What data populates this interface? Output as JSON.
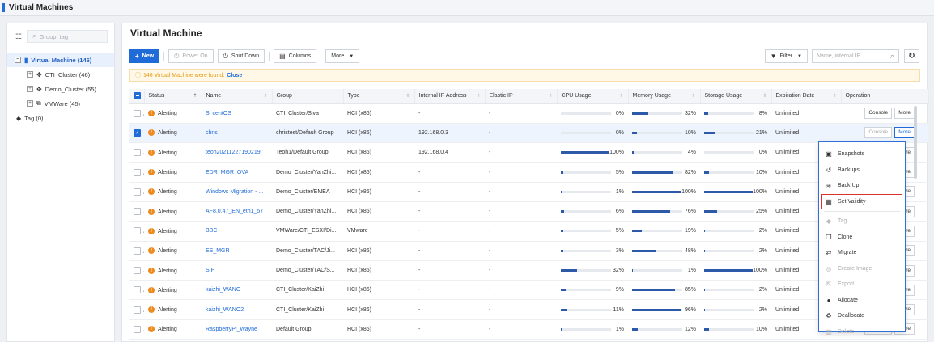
{
  "page": {
    "title": "Virtual Machines"
  },
  "sidebar": {
    "search_placeholder": "Group, tag",
    "tree": [
      {
        "label": "Virtual Machine (146)",
        "selected": true
      },
      {
        "label": "CTI_Cluster (46)"
      },
      {
        "label": "Demo_Cluster (55)"
      },
      {
        "label": "VMWare (45)"
      },
      {
        "label": "Tag (0)"
      }
    ]
  },
  "main": {
    "title": "Virtual Machine",
    "toolbar": {
      "new": "New",
      "power_on": "Power On",
      "shut_down": "Shut Down",
      "columns": "Columns",
      "more": "More",
      "filter": "Filter",
      "search_placeholder": "Name, internal IP"
    },
    "notice": {
      "text": "146 Virtual Machine were found.",
      "close": "Close"
    },
    "columns": [
      "Status",
      "Name",
      "Group",
      "Type",
      "Internal IP Address",
      "Elastic IP",
      "CPU Usage",
      "Memory Usage",
      "Storage Usage",
      "Expiration Date",
      "Operation"
    ],
    "operation_labels": {
      "console": "Console",
      "more": "More"
    },
    "rows": [
      {
        "status": "Alerting",
        "name": "S_centOS",
        "group": "CTI_Cluster/Siva",
        "type": "HCI (x86)",
        "ip": "-",
        "eip": "-",
        "cpu": 0,
        "cpu_label": "0%",
        "mem": 32,
        "mem_label": "32%",
        "sto": 8,
        "sto_label": "8%",
        "exp": "Unlimited",
        "checked": false
      },
      {
        "status": "Alerting",
        "name": "chris",
        "group": "christest/Default Group",
        "type": "HCI (x86)",
        "ip": "192.168.0.3",
        "eip": "-",
        "cpu": 0,
        "cpu_label": "0%",
        "mem": 10,
        "mem_label": "10%",
        "sto": 21,
        "sto_label": "21%",
        "exp": "Unlimited",
        "checked": true
      },
      {
        "status": "Alerting",
        "name": "teoh20211227190219",
        "group": "Teoh1/Default Group",
        "type": "HCI (x86)",
        "ip": "192.168.0.4",
        "eip": "-",
        "cpu": 100,
        "cpu_label": "100%",
        "mem": 4,
        "mem_label": "4%",
        "sto": 0,
        "sto_label": "0%",
        "exp": "Unlimited",
        "checked": false
      },
      {
        "status": "Alerting",
        "name": "EDR_MGR_OVA",
        "group": "Demo_Cluster/YanZhi...",
        "type": "HCI (x86)",
        "ip": "-",
        "eip": "-",
        "cpu": 5,
        "cpu_label": "5%",
        "mem": 82,
        "mem_label": "82%",
        "sto": 10,
        "sto_label": "10%",
        "exp": "Unlimited",
        "checked": false
      },
      {
        "status": "Alerting",
        "name": "Windows Migration - ...",
        "group": "Demo_Cluster/EMEA",
        "type": "HCI (x86)",
        "ip": "-",
        "eip": "-",
        "cpu": 1,
        "cpu_label": "1%",
        "mem": 100,
        "mem_label": "100%",
        "sto": 100,
        "sto_label": "100%",
        "exp": "Unlimited",
        "checked": false
      },
      {
        "status": "Alerting",
        "name": "AF8.0.47_EN_eth1_57",
        "group": "Demo_Cluster/YanZhi...",
        "type": "HCI (x86)",
        "ip": "-",
        "eip": "-",
        "cpu": 6,
        "cpu_label": "6%",
        "mem": 76,
        "mem_label": "76%",
        "sto": 25,
        "sto_label": "25%",
        "exp": "Unlimited",
        "checked": false
      },
      {
        "status": "Alerting",
        "name": "BBC",
        "group": "VMWare/CTI_ESXI/Di...",
        "type": "VMware",
        "ip": "-",
        "eip": "-",
        "cpu": 5,
        "cpu_label": "5%",
        "mem": 19,
        "mem_label": "19%",
        "sto": 2,
        "sto_label": "2%",
        "exp": "Unlimited",
        "checked": false
      },
      {
        "status": "Alerting",
        "name": "ES_MGR",
        "group": "Demo_Cluster/TAC/Ji...",
        "type": "HCI (x86)",
        "ip": "-",
        "eip": "-",
        "cpu": 3,
        "cpu_label": "3%",
        "mem": 48,
        "mem_label": "48%",
        "sto": 2,
        "sto_label": "2%",
        "exp": "Unlimited",
        "checked": false
      },
      {
        "status": "Alerting",
        "name": "SIP",
        "group": "Demo_Cluster/TAC/S...",
        "type": "HCI (x86)",
        "ip": "-",
        "eip": "-",
        "cpu": 32,
        "cpu_label": "32%",
        "mem": 1,
        "mem_label": "1%",
        "sto": 100,
        "sto_label": "100%",
        "exp": "Unlimited",
        "checked": false
      },
      {
        "status": "Alerting",
        "name": "kaizhi_WANO",
        "group": "CTI_Cluster/KaiZhi",
        "type": "HCI (x86)",
        "ip": "-",
        "eip": "-",
        "cpu": 9,
        "cpu_label": "9%",
        "mem": 85,
        "mem_label": "85%",
        "sto": 2,
        "sto_label": "2%",
        "exp": "Unlimited",
        "checked": false
      },
      {
        "status": "Alerting",
        "name": "kaizhi_WANO2",
        "group": "CTI_Cluster/KaiZhi",
        "type": "HCI (x86)",
        "ip": "-",
        "eip": "-",
        "cpu": 11,
        "cpu_label": "11%",
        "mem": 96,
        "mem_label": "96%",
        "sto": 2,
        "sto_label": "2%",
        "exp": "Unlimited",
        "checked": false
      },
      {
        "status": "Alerting",
        "name": "RaspberryPi_Wayne",
        "group": "Default Group",
        "type": "HCI (x86)",
        "ip": "-",
        "eip": "-",
        "cpu": 1,
        "cpu_label": "1%",
        "mem": 12,
        "mem_label": "12%",
        "sto": 10,
        "sto_label": "10%",
        "exp": "Unlimited",
        "checked": false
      }
    ]
  },
  "dropdown": {
    "items": [
      {
        "label": "Snapshots",
        "icon": "camera-icon",
        "disabled": false
      },
      {
        "label": "Backups",
        "icon": "history-icon",
        "disabled": false
      },
      {
        "label": "Back Up",
        "icon": "database-icon",
        "disabled": false
      },
      {
        "label": "Set Validity",
        "icon": "calendar-icon",
        "disabled": false,
        "highlighted": true
      },
      {
        "label": "Tag",
        "icon": "tag-icon",
        "disabled": true
      },
      {
        "label": "Clone",
        "icon": "copy-icon",
        "disabled": false
      },
      {
        "label": "Migrate",
        "icon": "swap-icon",
        "disabled": false
      },
      {
        "label": "Create Image",
        "icon": "image-icon",
        "disabled": true
      },
      {
        "label": "Export",
        "icon": "export-icon",
        "disabled": true
      },
      {
        "label": "Allocate",
        "icon": "allocate-icon",
        "disabled": false
      },
      {
        "label": "Deallocate",
        "icon": "deallocate-icon",
        "disabled": false
      },
      {
        "label": "Delete",
        "icon": "trash-icon",
        "disabled": true
      }
    ]
  },
  "colors": {
    "accent": "#1f6bd8",
    "alert": "#ee8b1e",
    "usage_bar": "#2c5aa8",
    "highlight": "#d9312c"
  }
}
